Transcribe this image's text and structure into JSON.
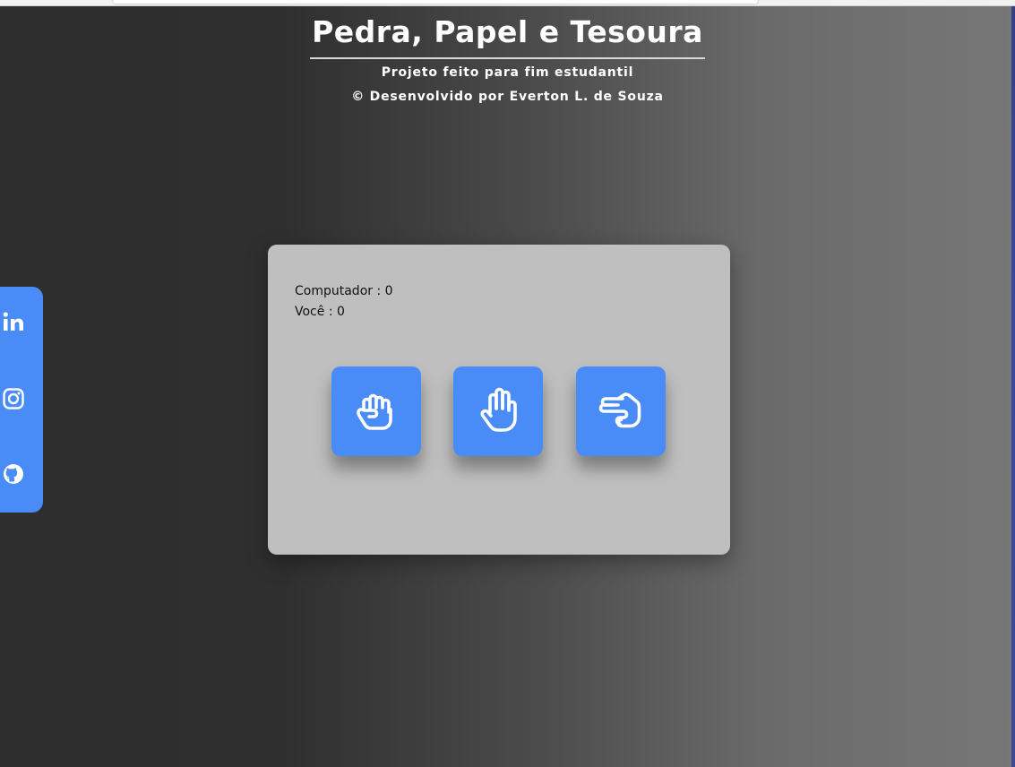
{
  "header": {
    "title": "Pedra, Papel e Tesoura",
    "subtitle": "Projeto feito para fim estudantil",
    "credits": "© Desenvolvido por Everton L. de Souza"
  },
  "social": {
    "items": [
      {
        "icon": "linkedin-icon"
      },
      {
        "icon": "instagram-icon"
      },
      {
        "icon": "github-icon"
      }
    ]
  },
  "scoreboard": {
    "computer": "Computador : 0",
    "player": "Você : 0"
  },
  "choices": [
    {
      "id": "rock",
      "icon": "fist-icon"
    },
    {
      "id": "paper",
      "icon": "open-hand-icon"
    },
    {
      "id": "scissors",
      "icon": "scissors-hand-icon"
    }
  ],
  "colors": {
    "accent": "#4a8cf7",
    "card": "#bfbfbf",
    "background_left": "#2e2e2e",
    "background_right": "#777777"
  }
}
